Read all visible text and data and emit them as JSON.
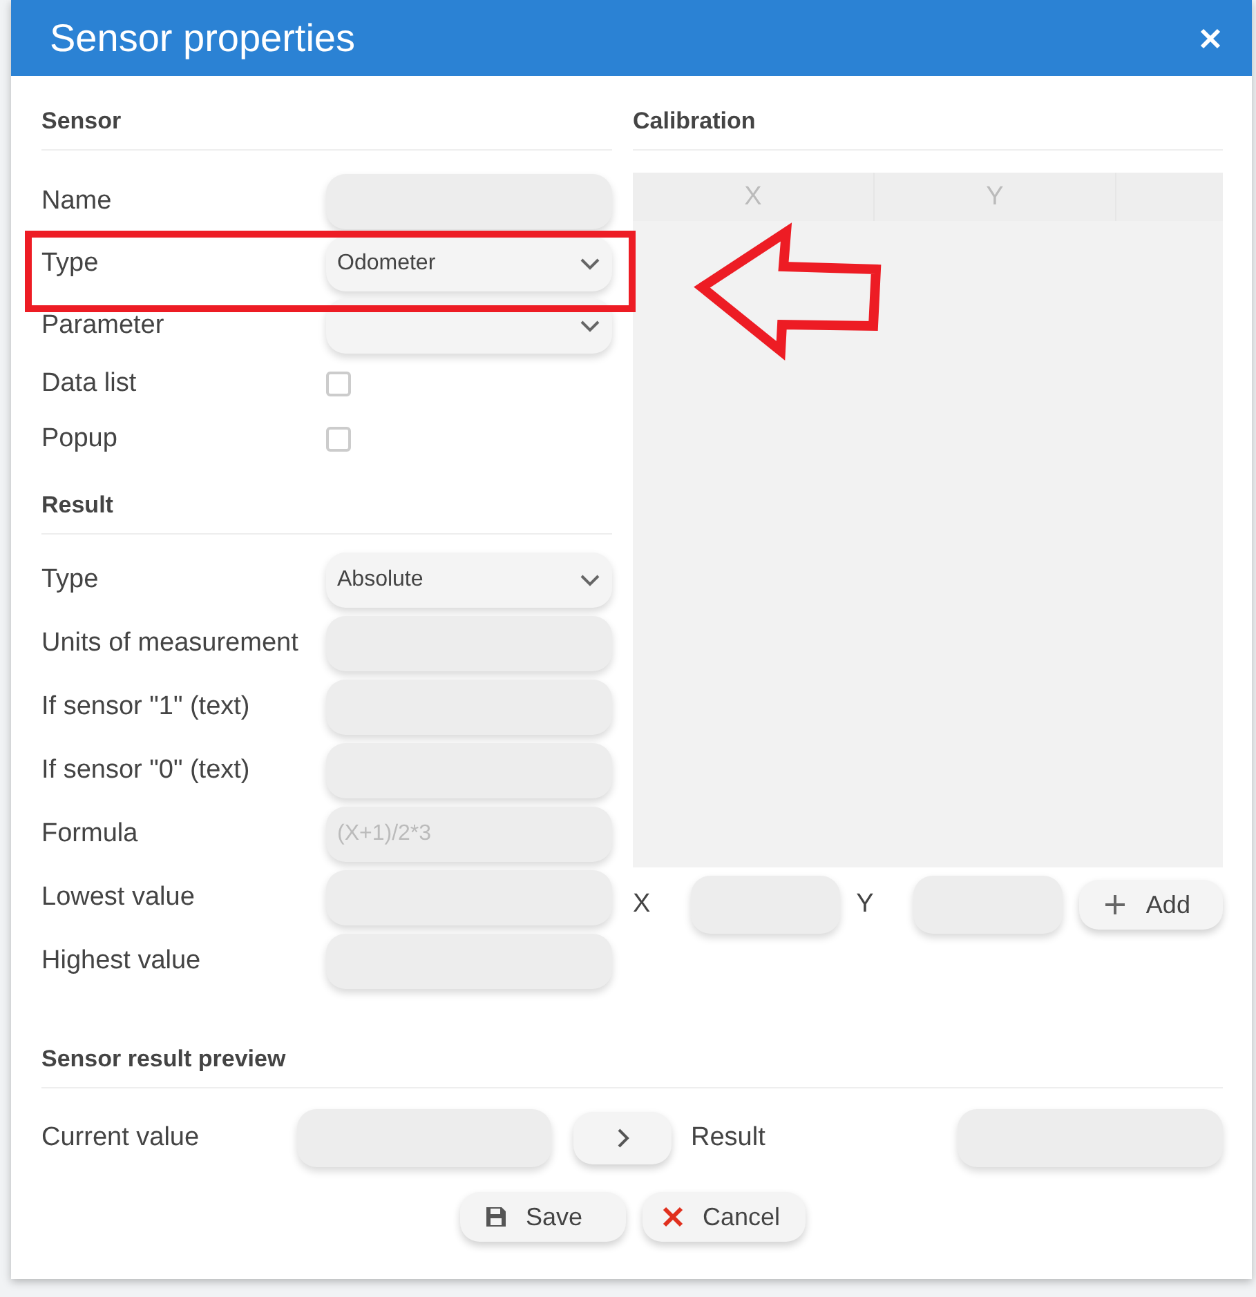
{
  "window": {
    "title": "Sensor properties"
  },
  "sensor": {
    "heading": "Sensor",
    "fields": [
      {
        "label": "Name",
        "kind": "text"
      },
      {
        "label": "Type",
        "kind": "select",
        "value": "Odometer"
      },
      {
        "label": "Parameter",
        "kind": "select"
      },
      {
        "label": "Data list",
        "kind": "checkbox",
        "checked": false
      },
      {
        "label": "Popup",
        "kind": "checkbox",
        "checked": false
      }
    ]
  },
  "result": {
    "heading": "Result",
    "fields": [
      {
        "label": "Type",
        "kind": "select",
        "value": "Absolute"
      },
      {
        "label": "Units of measurement",
        "kind": "text"
      },
      {
        "label": "If sensor \"1\" (text)",
        "kind": "text"
      },
      {
        "label": "If sensor \"0\" (text)",
        "kind": "text"
      },
      {
        "label": "Formula",
        "kind": "text",
        "placeholder": "(X+1)/2*3"
      },
      {
        "label": "Lowest value",
        "kind": "text"
      },
      {
        "label": "Highest value",
        "kind": "text"
      }
    ]
  },
  "calibration": {
    "heading": "Calibration",
    "columns": [
      "X",
      "Y"
    ],
    "inputs": [
      {
        "label": "X"
      },
      {
        "label": "Y"
      }
    ],
    "add_button": "Add"
  },
  "preview": {
    "heading": "Sensor result preview",
    "current_label": "Current value",
    "result_label": "Result"
  },
  "buttons": [
    {
      "label": "Save",
      "kind": "save"
    },
    {
      "label": "Cancel",
      "kind": "cancel"
    }
  ]
}
